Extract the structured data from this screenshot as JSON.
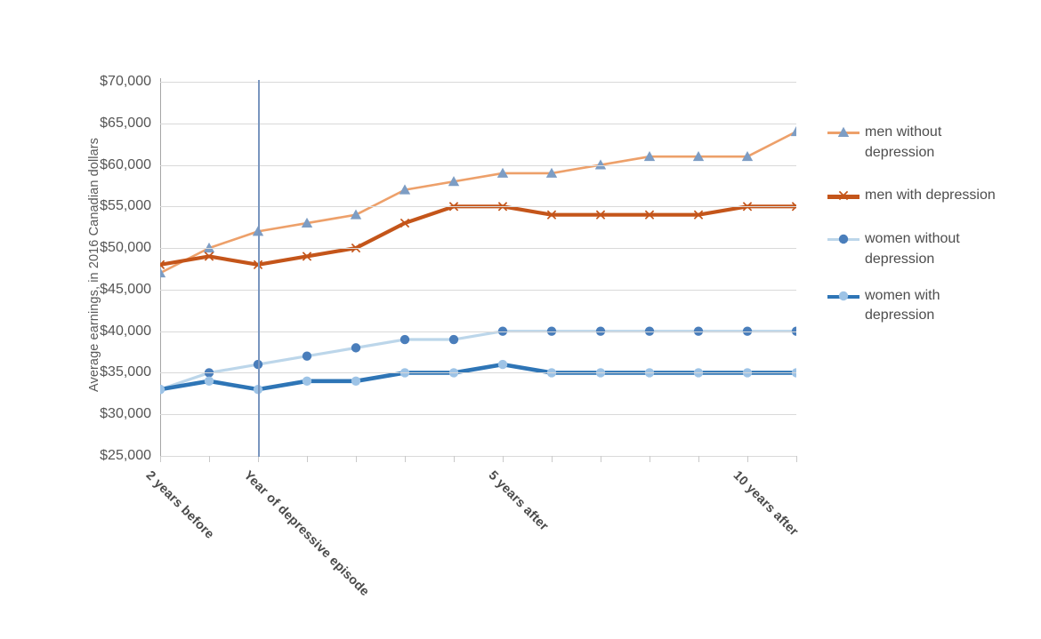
{
  "chart_data": {
    "type": "line",
    "title": "",
    "subtitle": "",
    "xlabel": "",
    "ylabel": "Average earnings, in 2016 Canadian dollars",
    "ylim": [
      25000,
      70000
    ],
    "y_ticks": [
      "$25,000",
      "$30,000",
      "$35,000",
      "$40,000",
      "$45,000",
      "$50,000",
      "$55,000",
      "$60,000",
      "$65,000",
      "$70,000"
    ],
    "y_tick_values": [
      25000,
      30000,
      35000,
      40000,
      45000,
      50000,
      55000,
      60000,
      65000,
      70000
    ],
    "grid": true,
    "legend_position": "right",
    "x_index": [
      0,
      1,
      2,
      3,
      4,
      5,
      6,
      7,
      8,
      9,
      10,
      11,
      12,
      13
    ],
    "x_tick_labels": [
      {
        "index": 0,
        "label": "2 years before"
      },
      {
        "index": 2,
        "label": "Year of depressive episode"
      },
      {
        "index": 7,
        "label": "5 years after"
      },
      {
        "index": 12,
        "label": "10 years after"
      }
    ],
    "annotations": [
      {
        "type": "vertical-line",
        "index": 2,
        "label": "Year of depressive episode",
        "color": "#7996bf"
      }
    ],
    "series": [
      {
        "name": "men without depression",
        "color": "#eda06a",
        "marker": "triangle",
        "marker_color": "#7d9dc4",
        "values": [
          47000,
          50000,
          52000,
          53000,
          54000,
          57000,
          58000,
          59000,
          59000,
          60000,
          61000,
          61000,
          61000,
          64000
        ]
      },
      {
        "name": "men with depression",
        "color": "#c4551a",
        "marker": "x",
        "marker_color": "#c4551a",
        "values": [
          48000,
          49000,
          48000,
          49000,
          50000,
          53000,
          55000,
          55000,
          54000,
          54000,
          54000,
          54000,
          55000,
          55000
        ]
      },
      {
        "name": "women without depression",
        "color": "#bcd6ea",
        "marker": "circle",
        "marker_color": "#4a7ebb",
        "values": [
          33000,
          35000,
          36000,
          37000,
          38000,
          39000,
          39000,
          40000,
          40000,
          40000,
          40000,
          40000,
          40000,
          40000
        ]
      },
      {
        "name": "women with depression",
        "color": "#2e75b6",
        "marker": "circle",
        "marker_color": "#9dc3e6",
        "values": [
          33000,
          34000,
          33000,
          34000,
          34000,
          35000,
          35000,
          36000,
          35000,
          35000,
          35000,
          35000,
          35000,
          35000
        ]
      }
    ]
  }
}
